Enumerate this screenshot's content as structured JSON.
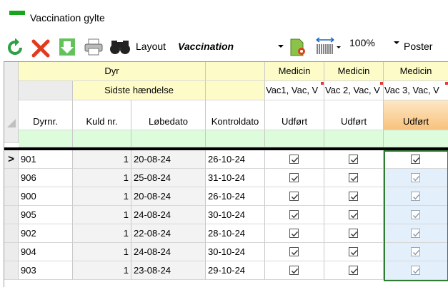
{
  "window": {
    "title": "Vaccination gylte"
  },
  "toolbar": {
    "refresh_icon": "refresh-icon",
    "delete_icon": "delete-icon",
    "export_icon": "export-icon",
    "print_icon": "print-icon",
    "binoculars_icon": "binoculars-icon",
    "layout_label": "Layout",
    "layout_value": "Vaccination",
    "zoom_value": "100%",
    "poster_label": "Poster"
  },
  "grid": {
    "group_row1": {
      "dyr": "Dyr",
      "medicin1": "Medicin",
      "medicin2": "Medicin",
      "medicin3": "Medicin"
    },
    "group_row2": {
      "sidste": "Sidste hændelse",
      "vac1": "Vac1, Vac, V",
      "vac2": "Vac 2, Vac, V",
      "vac3": "Vac 3, Vac, V"
    },
    "columns": [
      "Dyrnr.",
      "Kuld nr.",
      "Løbedato",
      "Kontroldato",
      "Udført",
      "Udført",
      "Udført"
    ],
    "current_row_marker": ">",
    "rows": [
      {
        "dyrnr": "901",
        "kuld": "1",
        "lobedato": "20-08-24",
        "kontroldato": "26-10-24",
        "u1": true,
        "u2": true,
        "u3": true
      },
      {
        "dyrnr": "906",
        "kuld": "1",
        "lobedato": "25-08-24",
        "kontroldato": "31-10-24",
        "u1": true,
        "u2": true,
        "u3": true
      },
      {
        "dyrnr": "900",
        "kuld": "1",
        "lobedato": "20-08-24",
        "kontroldato": "26-10-24",
        "u1": true,
        "u2": true,
        "u3": true
      },
      {
        "dyrnr": "905",
        "kuld": "1",
        "lobedato": "24-08-24",
        "kontroldato": "30-10-24",
        "u1": true,
        "u2": true,
        "u3": true
      },
      {
        "dyrnr": "902",
        "kuld": "1",
        "lobedato": "22-08-24",
        "kontroldato": "28-10-24",
        "u1": true,
        "u2": true,
        "u3": true
      },
      {
        "dyrnr": "904",
        "kuld": "1",
        "lobedato": "24-08-24",
        "kontroldato": "30-10-24",
        "u1": true,
        "u2": true,
        "u3": true
      },
      {
        "dyrnr": "903",
        "kuld": "1",
        "lobedato": "23-08-24",
        "kontroldato": "29-10-24",
        "u1": true,
        "u2": true,
        "u3": true
      }
    ]
  },
  "colors": {
    "accent_green": "#16a51b",
    "header_yellow": "#fdfcc8",
    "filter_green": "#dcfcdc",
    "selected_header": "#f8c27c"
  }
}
